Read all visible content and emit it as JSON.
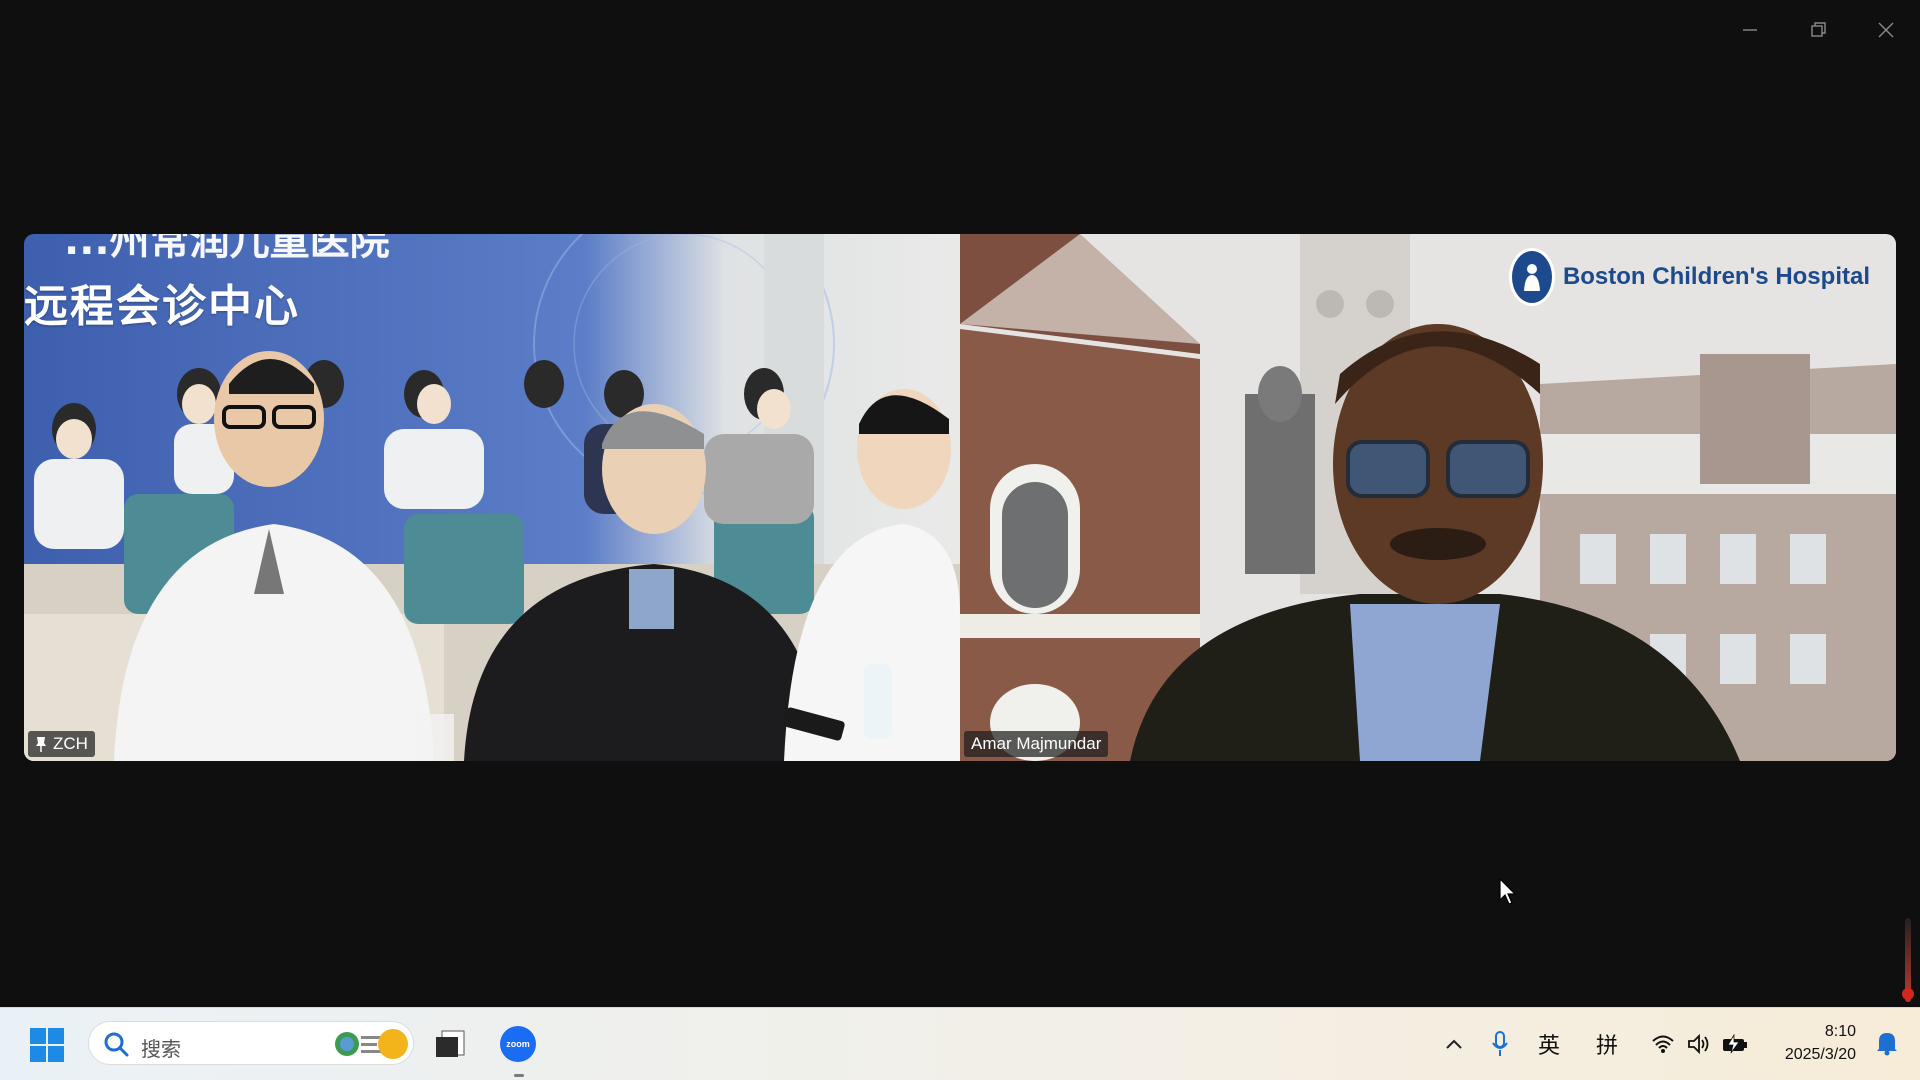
{
  "window": {
    "controls": [
      "minimize",
      "restore",
      "close"
    ]
  },
  "meeting": {
    "participants": [
      {
        "name": "ZCH",
        "pinned": true,
        "banner_line1": "...州常润儿童医院",
        "banner_line2": "远程会诊中心"
      },
      {
        "name": "Amar Majmundar",
        "pinned": false,
        "logo_text": "Boston Children's Hospital"
      }
    ]
  },
  "taskbar": {
    "search_placeholder": "搜索",
    "apps": [
      "file-explorer",
      "zoom"
    ],
    "zoom_label": "zoom",
    "tray": {
      "ime_lang": "英",
      "ime_mode": "拼",
      "time": "8:10",
      "date": "2025/3/20"
    }
  },
  "colors": {
    "zoom_blue": "#1a6cf2",
    "bch_blue": "#1d4a8c",
    "background": "#0f0f0f"
  }
}
